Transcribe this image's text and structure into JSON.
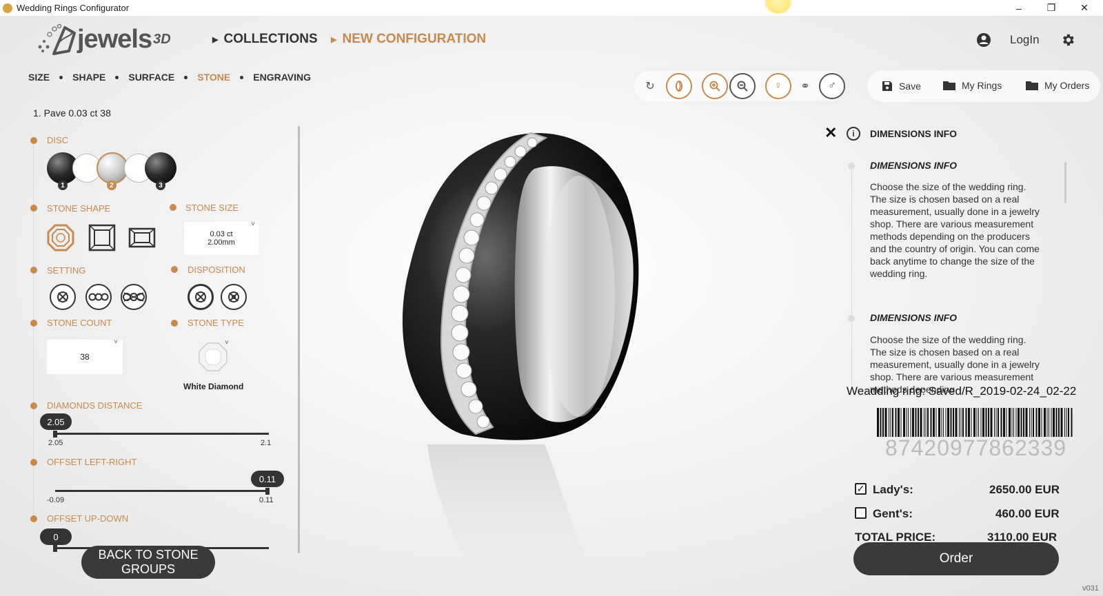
{
  "window": {
    "title": "Wedding Rings Configurator",
    "minimize": "–",
    "restore": "❐",
    "close": "✕"
  },
  "brand": {
    "name": "jewels",
    "suffix": "3D"
  },
  "nav": {
    "collections": "COLLECTIONS",
    "new_configuration": "NEW CONFIGURATION",
    "login": "LogIn"
  },
  "steps": [
    "SIZE",
    "SHAPE",
    "SURFACE",
    "STONE",
    "ENGRAVING"
  ],
  "active_step": "STONE",
  "actions": {
    "save": "Save",
    "my_rings": "My Rings",
    "my_orders": "My Orders"
  },
  "left": {
    "stone_group": "1. Pave 0.03 ct 38",
    "disc_label": "DISC",
    "disc_badges": [
      "1",
      "2",
      "3"
    ],
    "stone_shape_label": "STONE SHAPE",
    "stone_size_label": "STONE SIZE",
    "stone_size_ct": "0.03 ct",
    "stone_size_mm": "2.00mm",
    "setting_label": "SETTING",
    "disposition_label": "DISPOSITION",
    "stone_count_label": "STONE COUNT",
    "stone_count_value": "38",
    "stone_type_label": "STONE TYPE",
    "stone_type_value": "White Diamond",
    "diamonds_distance": {
      "label": "DIAMONDS DISTANCE",
      "value": "2.05",
      "min": "2.05",
      "max": "2.1",
      "fraction": 0.0
    },
    "offset_lr": {
      "label": "OFFSET LEFT-RIGHT",
      "value": "0.11",
      "min": "-0.09",
      "max": "0.11",
      "fraction": 1.0
    },
    "offset_ud": {
      "label": "OFFSET UP-DOWN",
      "value": "0",
      "fraction": 0.0
    },
    "back_button_line1": "BACK TO STONE",
    "back_button_line2": "GROUPS"
  },
  "right": {
    "header": "DIMENSIONS INFO",
    "entries": [
      {
        "title": "DIMENSIONS INFO",
        "text": "Choose the size of the wedding ring. The size is chosen based on a real measurement, usually done in a jewelry shop. There are various measurement methods depending on the producers and the country of origin. You can come back anytime to change the size of the wedding ring."
      },
      {
        "title": "DIMENSIONS INFO",
        "text": "Choose the size of the wedding ring. The size is chosen based on a real measurement, usually done in a jewelry shop. There are various measurement methods depending"
      }
    ],
    "saved_name": "Weadding ring: Saved/R_2019-02-24_02-22",
    "barcode_number": "87420977862339",
    "ladys_label": "Lady's:",
    "ladys_price": "2650.00 EUR",
    "ladys_checked": true,
    "gents_label": "Gent's:",
    "gents_price": "460.00 EUR",
    "gents_checked": false,
    "total_label": "TOTAL PRICE:",
    "total_price": "3110.00 EUR",
    "order_button": "Order",
    "version": "v031"
  },
  "colors": {
    "accent": "#c68a4f",
    "dark": "#3a3a3a"
  }
}
